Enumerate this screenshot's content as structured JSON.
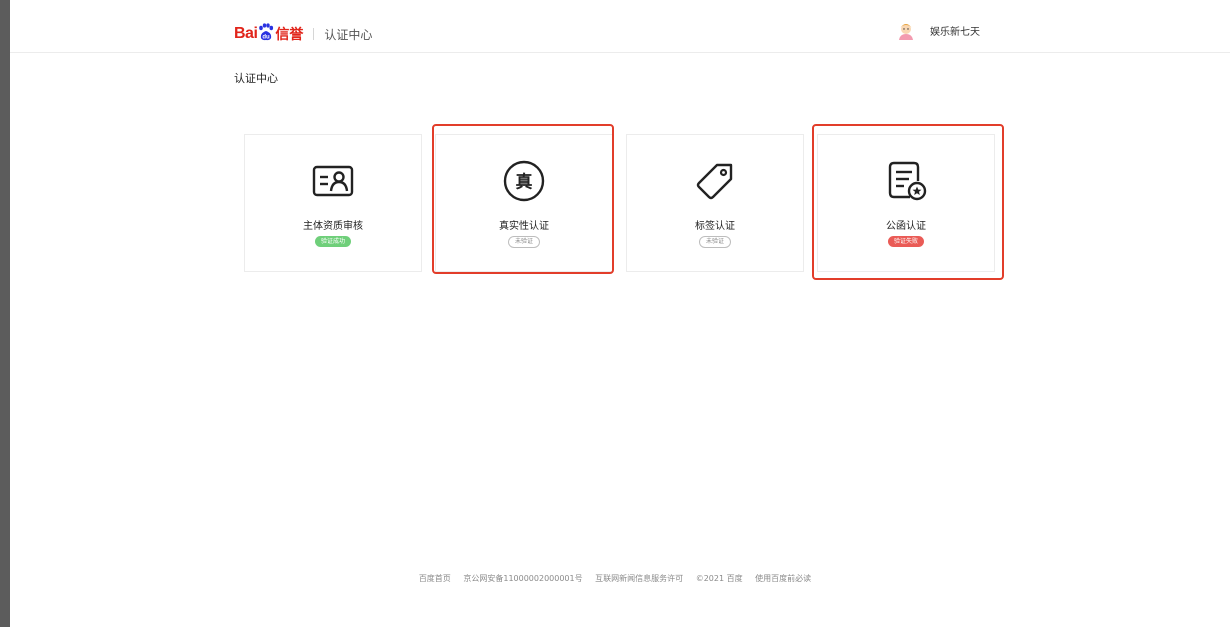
{
  "header": {
    "logo_text": "Bai",
    "logo_product": "信誉",
    "section_title": "认证中心",
    "user_name": "娱乐新七天"
  },
  "page": {
    "title": "认证中心"
  },
  "cards": [
    {
      "label": "主体资质审核",
      "status": "验证成功",
      "icon": "id-card-icon"
    },
    {
      "label": "真实性认证",
      "status": "未验证",
      "icon": "zhen-seal-icon"
    },
    {
      "label": "标签认证",
      "status": "未验证",
      "icon": "tag-icon"
    },
    {
      "label": "公函认证",
      "status": "验证失败",
      "icon": "document-star-icon"
    }
  ],
  "footer": {
    "links": [
      "百度首页",
      "京公网安备11000002000001号",
      "互联网新闻信息服务许可",
      "©2021 百度",
      "使用百度前必读"
    ]
  },
  "colors": {
    "brand": "#e1251b",
    "success": "#6fcf7a",
    "fail": "#ea5b56",
    "highlight": "#e23d2a"
  }
}
